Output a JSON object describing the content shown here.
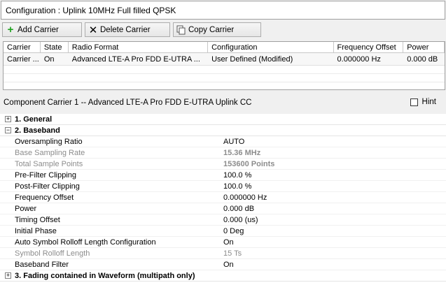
{
  "config_title": "Configuration : Uplink 10MHz Full filled QPSK",
  "toolbar": {
    "add_label": "Add Carrier",
    "delete_label": "Delete Carrier",
    "copy_label": "Copy Carrier"
  },
  "grid": {
    "headers": [
      "Carrier",
      "State",
      "Radio Format",
      "Configuration",
      "Frequency Offset",
      "Power"
    ],
    "row": [
      "Carrier ...",
      "On",
      "Advanced LTE-A Pro FDD E-UTRA ...",
      "User Defined (Modified)",
      "0.000000 Hz",
      "0.000 dB"
    ]
  },
  "component_title": "Component Carrier 1 -- Advanced LTE-A Pro FDD E-UTRA Uplink CC",
  "hint_label": "Hint",
  "sections": {
    "general": "1. General",
    "baseband": "2. Baseband",
    "fading": "3. Fading contained in Waveform (multipath only)"
  },
  "baseband_props": [
    {
      "label": "Oversampling Ratio",
      "value": "AUTO"
    },
    {
      "label": "Base Sampling Rate",
      "value": "15.36 MHz"
    },
    {
      "label": "Total Sample Points",
      "value": "153600 Points"
    },
    {
      "label": "Pre-Filter Clipping",
      "value": "100.0 %"
    },
    {
      "label": "Post-Filter Clipping",
      "value": "100.0 %"
    },
    {
      "label": "Frequency Offset",
      "value": "0.000000 Hz"
    },
    {
      "label": "Power",
      "value": "0.000 dB"
    },
    {
      "label": "Timing Offset",
      "value": "0.000 (us)"
    },
    {
      "label": "Initial Phase",
      "value": "0 Deg"
    },
    {
      "label": "Auto Symbol Rolloff Length Configuration",
      "value": "On"
    },
    {
      "label": "Symbol Rolloff Length",
      "value": "15 Ts"
    },
    {
      "label": "Baseband Filter",
      "value": "On"
    }
  ]
}
